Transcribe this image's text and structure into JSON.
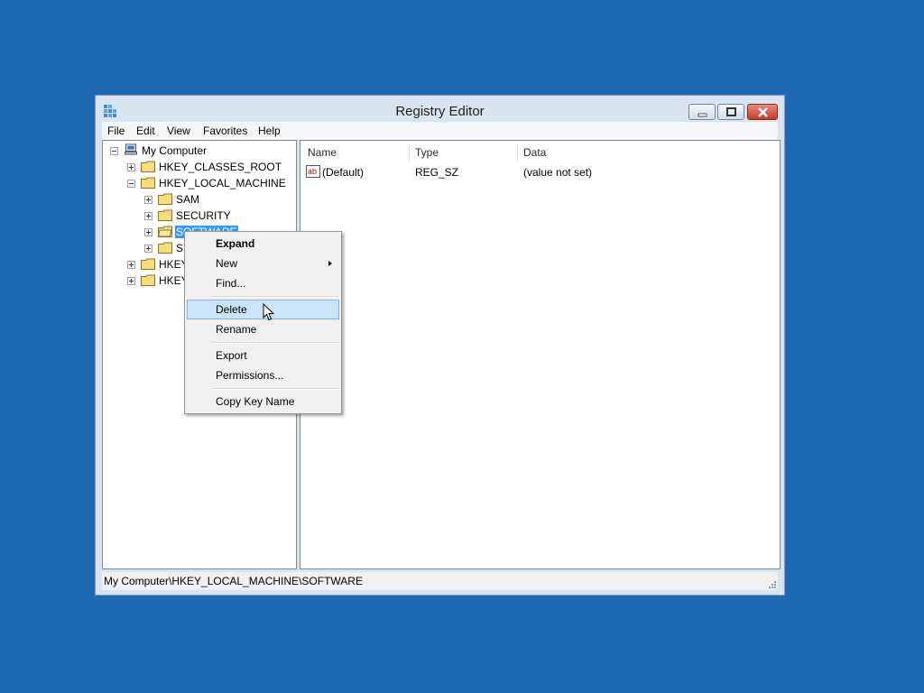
{
  "window": {
    "title": "Registry Editor"
  },
  "menubar": [
    "File",
    "Edit",
    "View",
    "Favorites",
    "Help"
  ],
  "tree": {
    "root": "My Computer",
    "nodes": [
      {
        "label": "HKEY_CLASSES_ROOT"
      },
      {
        "label": "HKEY_LOCAL_MACHINE"
      },
      {
        "label": "SAM"
      },
      {
        "label": "SECURITY"
      },
      {
        "label": "SOFTWARE"
      },
      {
        "label": "SY"
      },
      {
        "label": "HKEY"
      },
      {
        "label": "HKEY"
      }
    ]
  },
  "list": {
    "columns": [
      "Name",
      "Type",
      "Data"
    ],
    "rows": [
      {
        "name": "(Default)",
        "type": "REG_SZ",
        "data": "(value not set)"
      }
    ]
  },
  "context_menu": {
    "items": [
      "Expand",
      "New",
      "Find...",
      "Delete",
      "Rename",
      "Export",
      "Permissions...",
      "Copy Key Name"
    ],
    "hovered": "Delete"
  },
  "statusbar": {
    "path": "My Computer\\HKEY_LOCAL_MACHINE\\SOFTWARE"
  },
  "icons": [
    "registry-editor-icon",
    "minimize-icon",
    "maximize-icon",
    "close-icon",
    "computer-icon",
    "folder-icon",
    "string-value-icon",
    "mouse-cursor-icon",
    "resize-grip-icon"
  ],
  "colors": {
    "desktop": "#1f69b4",
    "selection": "#3399ff",
    "menu_hover": "#cce4f7"
  }
}
